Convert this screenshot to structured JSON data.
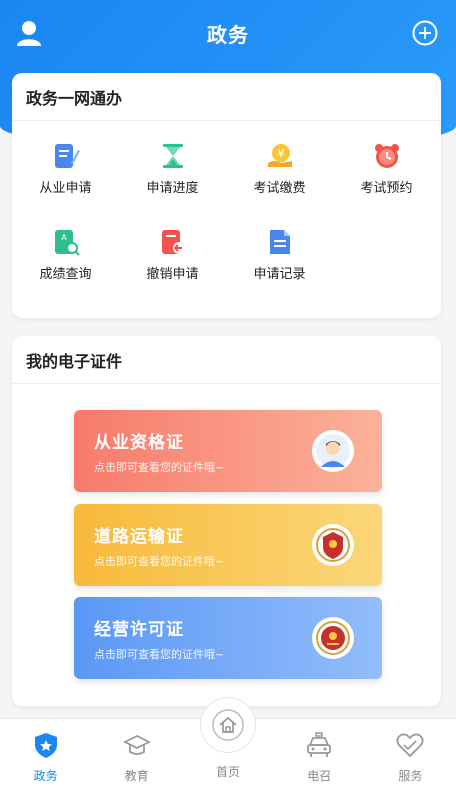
{
  "header": {
    "title": "政务"
  },
  "services": {
    "title": "政务一网通办",
    "items": [
      {
        "label": "从业申请",
        "icon": "form-edit-icon"
      },
      {
        "label": "申请进度",
        "icon": "hourglass-icon"
      },
      {
        "label": "考试缴费",
        "icon": "yen-coin-icon"
      },
      {
        "label": "考试预约",
        "icon": "alarm-clock-icon"
      },
      {
        "label": "成绩查询",
        "icon": "doc-search-icon"
      },
      {
        "label": "撤销申请",
        "icon": "doc-undo-icon"
      },
      {
        "label": "申请记录",
        "icon": "doc-list-icon"
      }
    ]
  },
  "certificates": {
    "title": "我的电子证件",
    "items": [
      {
        "name": "从业资格证",
        "hint": "点击即可查看您的证件哦~",
        "color": "#f87a6b",
        "icon": "person-avatar-icon"
      },
      {
        "name": "道路运输证",
        "hint": "点击即可查看您的证件哦~",
        "color": "#f7b93a",
        "icon": "emblem-icon"
      },
      {
        "name": "经营许可证",
        "hint": "点击即可查看您的证件哦~",
        "color": "#5a98f6",
        "icon": "emblem-icon"
      }
    ]
  },
  "tabbar": {
    "items": [
      {
        "label": "政务",
        "active": true
      },
      {
        "label": "教育",
        "active": false
      },
      {
        "label": "首页",
        "active": false
      },
      {
        "label": "电召",
        "active": false
      },
      {
        "label": "服务",
        "active": false
      }
    ]
  },
  "colors": {
    "primary": "#1a86f2",
    "tab_inactive": "#888888"
  }
}
